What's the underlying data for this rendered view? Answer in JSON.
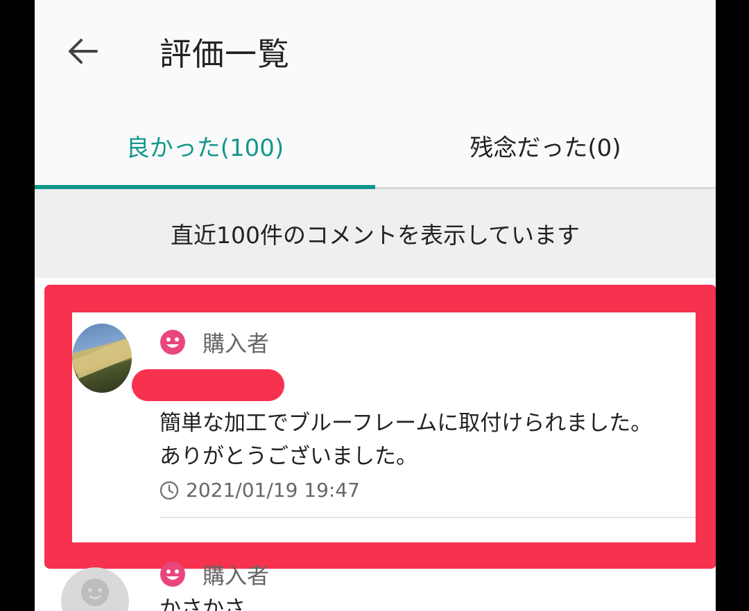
{
  "header": {
    "back_icon": "arrow-left-icon",
    "title": "評価一覧"
  },
  "tabs": [
    {
      "label": "良かった(100)",
      "active": true
    },
    {
      "label": "残念だった(0)",
      "active": false
    }
  ],
  "notice": "直近100件のコメントを表示しています",
  "colors": {
    "accent": "#12978b",
    "highlight": "#f7324f",
    "smile_icon": "#e8467c"
  },
  "reviews": [
    {
      "role": "購入者",
      "role_icon": "smile-face-icon",
      "comment": "簡単な加工でブルーフレームに取付けられました。\nありがとうございました。",
      "timestamp": "2021/01/19 19:47"
    },
    {
      "role": "購入者",
      "role_icon": "smile-face-icon",
      "comment": "かさかさ"
    }
  ]
}
